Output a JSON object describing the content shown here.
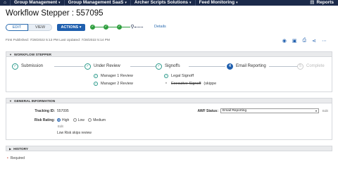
{
  "topnav": {
    "home_icon": "home-icon",
    "items": [
      {
        "label": "Group Management"
      },
      {
        "label": "Group Management SaaS"
      },
      {
        "label": "Archer Scripts Solutions"
      },
      {
        "label": "Feed Monitoring"
      }
    ],
    "reports_label": "Reports"
  },
  "page": {
    "title": "Workflow Stepper : 557095",
    "edit_label": "EDIT",
    "view_label": "VIEW",
    "actions_label": "ACTIONS",
    "details_label": "Details",
    "published": "First Published: 7/28/2022 5:13 PM Last Updated: 7/28/2022 5:14 PM"
  },
  "workflow": {
    "header": "WORKFLOW STEPPER",
    "steps": [
      {
        "label": "Submission",
        "state": "done"
      },
      {
        "label": "Under Review",
        "state": "done"
      },
      {
        "label": "Signoffs",
        "state": "done"
      },
      {
        "label": "Email Reporting",
        "state": "current",
        "number": "4"
      },
      {
        "label": "Complete",
        "state": "pending",
        "number": "5"
      }
    ],
    "under_review_sub": [
      "Manager 1 Review",
      "Manager 2 Review"
    ],
    "signoffs_sub": [
      "Legal Signoff",
      "Executive Signoff",
      "(skippe"
    ]
  },
  "general": {
    "header": "GENERAL INFORMATION",
    "tracking_label": "Tracking ID:",
    "tracking_value": "557095",
    "risk_label": "Risk Rating:",
    "risk_options": [
      "High",
      "Low",
      "Medium"
    ],
    "risk_selected": "High",
    "edit_link": "Edit",
    "risk_note": "Low Risk skips review",
    "awf_label": "AWF Status:",
    "awf_value": "Email Reporting",
    "awf_edit": "Edit"
  },
  "history": {
    "header": "HISTORY"
  },
  "footer": {
    "required_label": "Required"
  },
  "colors": {
    "nav_bg": "#1b2a4a",
    "primary": "#1f5fae",
    "done_green": "#2e9e3e",
    "step_teal": "#2b9a8b"
  }
}
